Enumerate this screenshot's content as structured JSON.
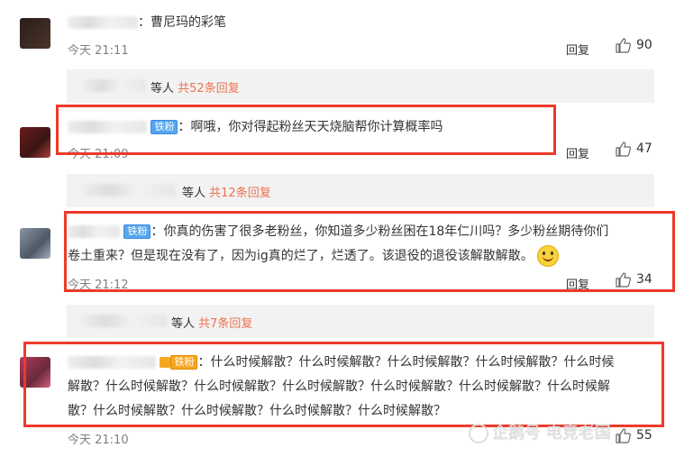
{
  "comments": [
    {
      "text": "：曹尼玛的彩笔",
      "time": "今天 21:11",
      "reply": "回复",
      "likes": "90"
    },
    {
      "badge": "铁粉",
      "text": "：啊哦，你对得起粉丝天天烧脑帮你计算概率吗",
      "time": "今天 21:09",
      "reply": "回复",
      "likes": "47"
    },
    {
      "badge": "铁粉",
      "text_line1": "：你真的伤害了很多老粉丝，你知道多少粉丝困在18年仁川吗？多少粉丝期待你们",
      "text_line2": "卷土重来？但是现在没有了，因为ig真的烂了，烂透了。该退役的退役该解散解散。",
      "time": "今天 21:12",
      "reply": "回复",
      "likes": "34"
    },
    {
      "badge": "铁粉",
      "text_line1": "：什么时候解散？什么时候解散？什么时候解散？什么时候解散？什么时候",
      "text_line2": "解散？什么时候解散？什么时候解散？什么时候解散？什么时候解散？什么时候解散？什么时候解",
      "text_line3": "散？什么时候解散？什么时候解散？什么时候解散？什么时候解散？",
      "time": "今天 21:10",
      "likes": "55"
    }
  ],
  "subreplies": [
    {
      "suffix": "等人",
      "link": "共52条回复"
    },
    {
      "suffix": "等人",
      "link": "共12条回复"
    },
    {
      "suffix": "等人",
      "link": "共7条回复"
    }
  ],
  "watermark": "企鹅号 电竞老国"
}
